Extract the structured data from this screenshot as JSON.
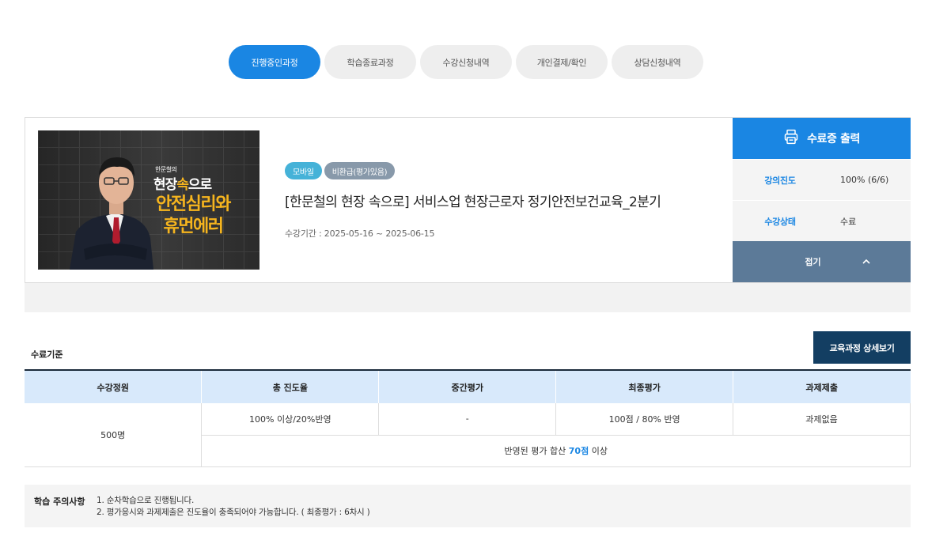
{
  "tabs": [
    {
      "label": "진행중인과정",
      "active": true
    },
    {
      "label": "학습종료과정",
      "active": false
    },
    {
      "label": "수강신청내역",
      "active": false
    },
    {
      "label": "개인결제/확인",
      "active": false
    },
    {
      "label": "상담신청내역",
      "active": false
    }
  ],
  "course": {
    "thumbnail": {
      "small_text": "한문철의",
      "line1_white_a": "현장",
      "line1_yellow": "속",
      "line1_white_b": "으로",
      "line2": "안전심리와",
      "line3": "휴먼에러"
    },
    "badges": {
      "mobile": "모바일",
      "refund": "비환급(평가있음)"
    },
    "title": "[한문철의 현장 속으로] 서비스업 현장근로자 정기안전보건교육_2분기",
    "period": "수강기간 : 2025-05-16 ~ 2025-06-15"
  },
  "side_panel": {
    "cert_label": "수료증 출력",
    "progress_label": "강의진도",
    "progress_value": "100% (6/6)",
    "progress_fraction": 1.0,
    "status_label": "수강상태",
    "status_value": "수료",
    "fold_label": "접기"
  },
  "criteria": {
    "title": "수료기준",
    "detail_button": "교육과정 상세보기",
    "headers": [
      "수강정원",
      "총 진도율",
      "중간평가",
      "최종평가",
      "과제제출"
    ],
    "row": {
      "capacity": "500명",
      "progress": "100% 이상/20%반영",
      "midterm": "-",
      "final": "100점 / 80% 반영",
      "assignment": "과제없음"
    },
    "total": {
      "prefix": "반영된 평가 합산 ",
      "score": "70점",
      "suffix": " 이상"
    }
  },
  "notice": {
    "label": "학습 주의사항",
    "lines": [
      "1. 순차학습으로 진행됩니다.",
      "2. 평가응시와 과제제출은 진도율이 충족되어야 가능합니다. ( 최종평가 : 6차시 )"
    ]
  },
  "colors": {
    "accent": "#1a86e3",
    "dark_button": "#133e62",
    "fold_button": "#5c7a98",
    "table_header": "#d8e9fb",
    "badge_mobile": "#45b2d8",
    "badge_refund": "#8899aa",
    "thumbnail_highlight": "#f6b51e"
  },
  "icons": {
    "cert": "printer-icon",
    "fold": "chevron-up-icon"
  }
}
